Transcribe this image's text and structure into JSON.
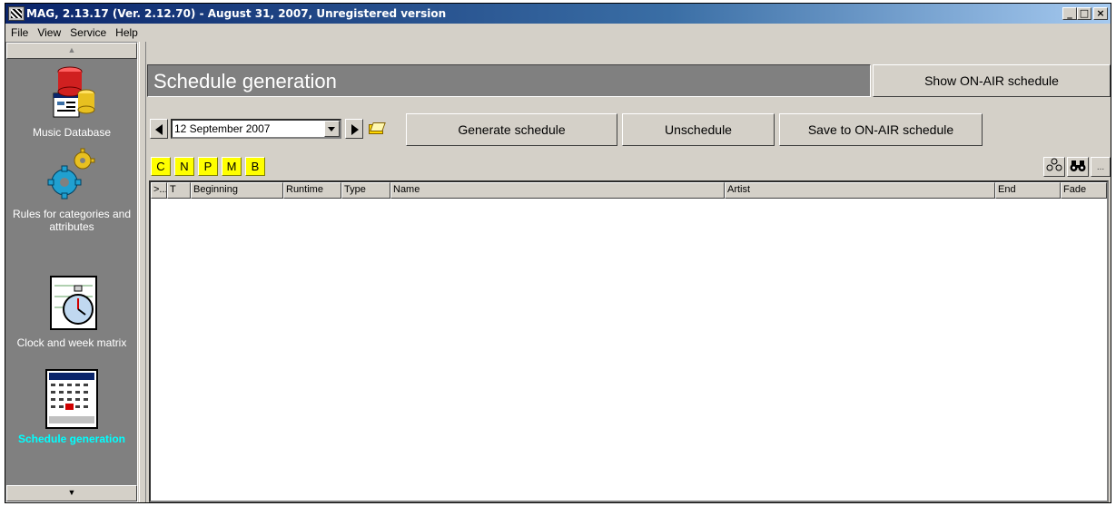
{
  "window": {
    "title": "MAG, 2.13.17 (Ver. 2.12.70) - August 31, 2007, Unregistered version",
    "min_label": "_",
    "max_label": "□",
    "close_label": "×"
  },
  "menu": {
    "items": [
      {
        "label": "File"
      },
      {
        "label": "View"
      },
      {
        "label": "Service"
      },
      {
        "label": "Help"
      }
    ]
  },
  "sidebar": {
    "scroll_up": "▲",
    "scroll_down": "▼",
    "items": [
      {
        "label": "Music Database",
        "icon": "database-icon"
      },
      {
        "label": "Rules for categories and attributes",
        "icon": "gears-icon"
      },
      {
        "label": "Clock and week matrix",
        "icon": "clock-icon"
      },
      {
        "label": "Schedule generation",
        "icon": "calendar-icon",
        "active": true
      }
    ]
  },
  "header": {
    "title": "Schedule generation",
    "onair_button": "Show ON-AIR schedule"
  },
  "toolbar": {
    "date_value": "12 September 2007",
    "generate": "Generate schedule",
    "unschedule": "Unschedule",
    "save_onair": "Save to ON-AIR schedule"
  },
  "categories": [
    "C",
    "N",
    "P",
    "M",
    "B"
  ],
  "right_tools": {
    "more_label": "..."
  },
  "grid": {
    "columns": [
      ">...",
      "T",
      "Beginning",
      "Runtime",
      "Type",
      "Name",
      "Artist",
      "End",
      "Fade"
    ]
  },
  "colors": {
    "category_bg": "#ffff00",
    "active_sidebar_text": "#00ffff",
    "header_bg": "#808080"
  }
}
